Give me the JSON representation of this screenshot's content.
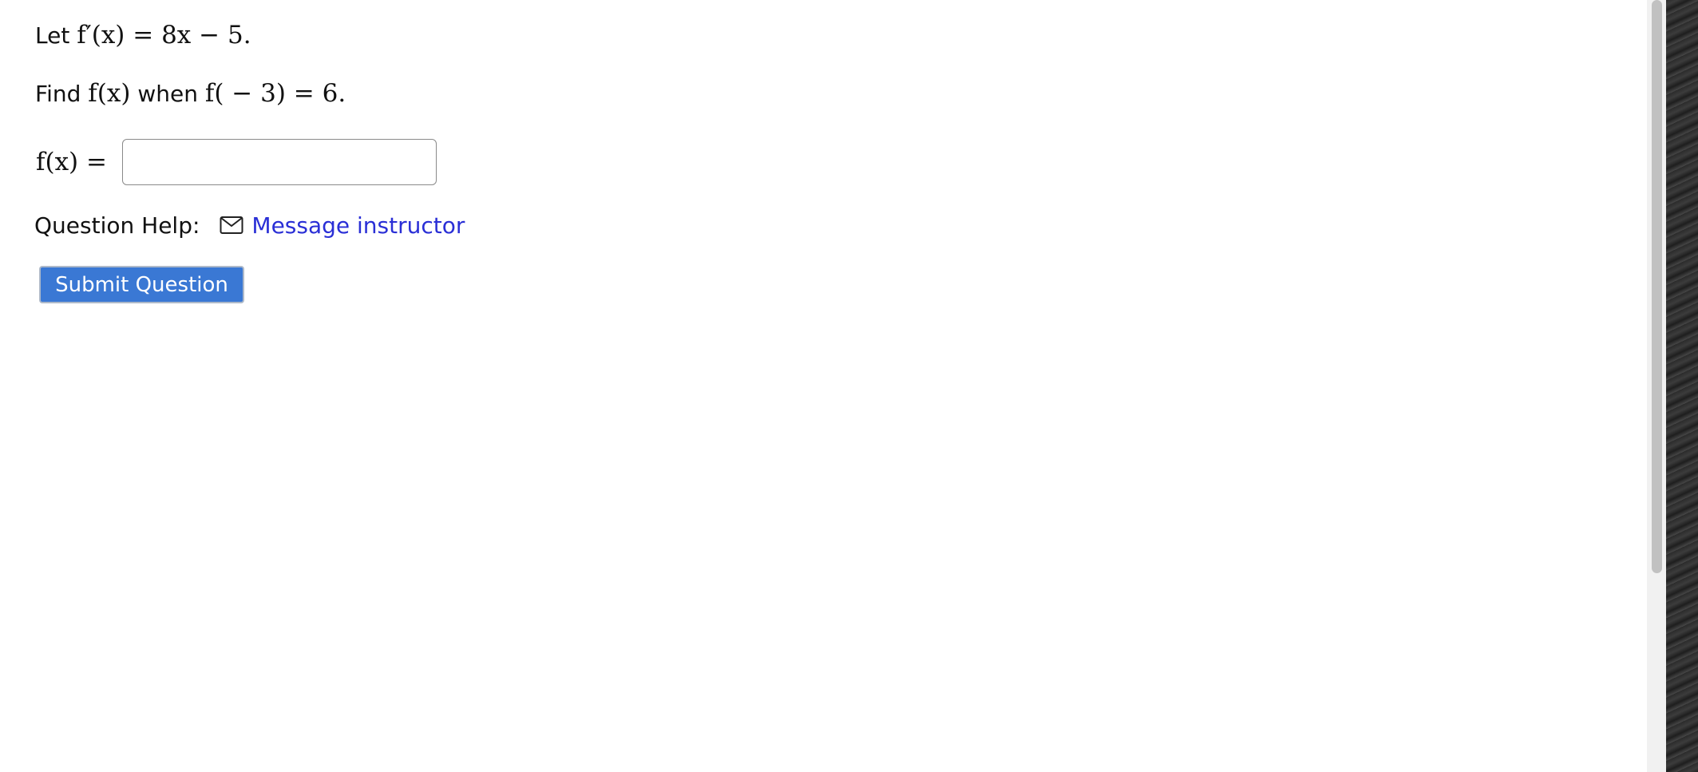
{
  "question": {
    "line1": {
      "lead": "Let ",
      "math": "f′(x) = 8x − 5."
    },
    "line2": {
      "lead": "Find ",
      "math1": "f(x)",
      "middle": " when ",
      "math2": "f( − 3) = 6."
    },
    "answer_label": "f(x) =",
    "answer_input": {
      "value": "",
      "placeholder": ""
    }
  },
  "help": {
    "label": "Question Help:",
    "icon": "mail-icon",
    "link_label": "Message instructor"
  },
  "actions": {
    "submit_label": "Submit Question"
  },
  "colors": {
    "link": "#2a2fd6",
    "submit_bg": "#3a78d4"
  }
}
